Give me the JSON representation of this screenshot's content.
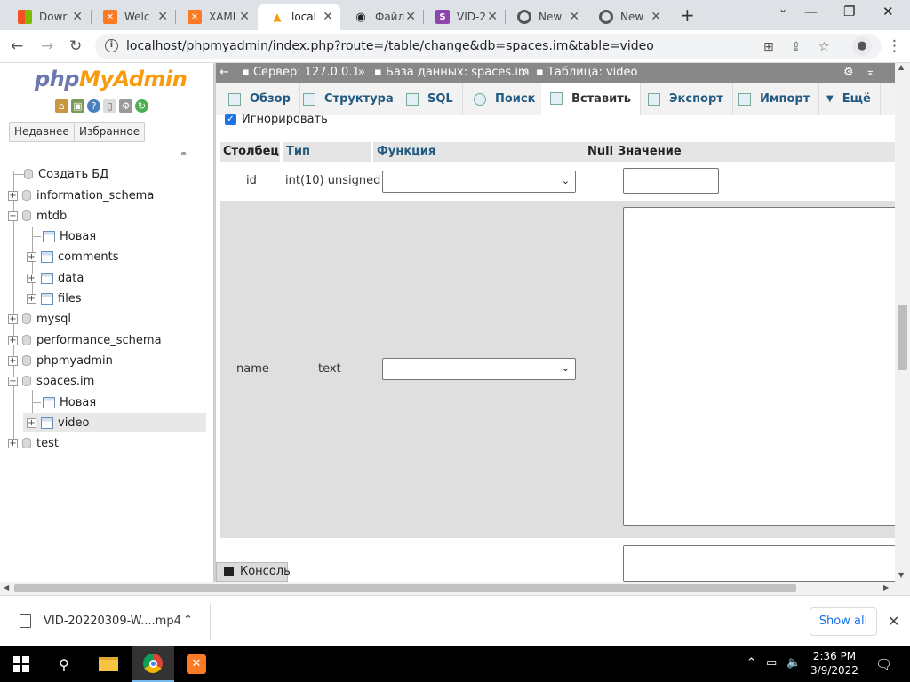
{
  "browser": {
    "tabs": [
      {
        "label": "Dowr",
        "icon": "windows-icon",
        "active": false
      },
      {
        "label": "Welc",
        "icon": "xampp-icon",
        "active": false
      },
      {
        "label": "XAMI",
        "icon": "xampp-icon",
        "active": false
      },
      {
        "label": "local",
        "icon": "phpmyadmin-icon",
        "active": true
      },
      {
        "label": "Файл",
        "icon": "eye-icon",
        "active": false
      },
      {
        "label": "VID-2",
        "icon": "s-icon",
        "active": false
      },
      {
        "label": "New",
        "icon": "chrome-icon",
        "active": false
      },
      {
        "label": "New",
        "icon": "chrome-icon",
        "active": false
      }
    ],
    "url": "localhost/phpmyadmin/index.php?route=/table/change&db=spaces.im&table=video"
  },
  "sidebar": {
    "logo_php": "php",
    "logo_my": "MyAdmin",
    "recent_label": "Недавнее",
    "favorites_label": "Избранное",
    "tree": {
      "create_db": "Создать БД",
      "information_schema": "information_schema",
      "mtdb": "mtdb",
      "mtdb_new": "Новая",
      "comments": "comments",
      "data": "data",
      "files": "files",
      "mysql": "mysql",
      "performance_schema": "performance_schema",
      "phpmyadmin": "phpmyadmin",
      "spaces": "spaces.im",
      "spaces_new": "Новая",
      "video": "video",
      "test": "test"
    }
  },
  "breadcrumb": {
    "server": "Сервер: 127.0.0.1",
    "database": "База данных: spaces.im",
    "table": "Таблица: video",
    "sep": "»"
  },
  "menu": {
    "browse": "Обзор",
    "structure": "Структура",
    "sql": "SQL",
    "search": "Поиск",
    "insert": "Вставить",
    "export": "Экспорт",
    "import": "Импорт",
    "more": "Ещё"
  },
  "form": {
    "ignore_label": "Игнорировать",
    "headers": {
      "column": "Столбец",
      "type": "Тип",
      "function": "Функция",
      "null": "Null",
      "value": "Значение"
    },
    "rows": [
      {
        "column": "id",
        "type": "int(10) unsigned",
        "function": ""
      },
      {
        "column": "name",
        "type": "text",
        "function": ""
      }
    ]
  },
  "console_label": "Консоль",
  "download": {
    "filename": "VID-20220309-W....mp4",
    "show_all": "Show all"
  },
  "taskbar": {
    "time": "2:36 PM",
    "date": "3/9/2022"
  }
}
